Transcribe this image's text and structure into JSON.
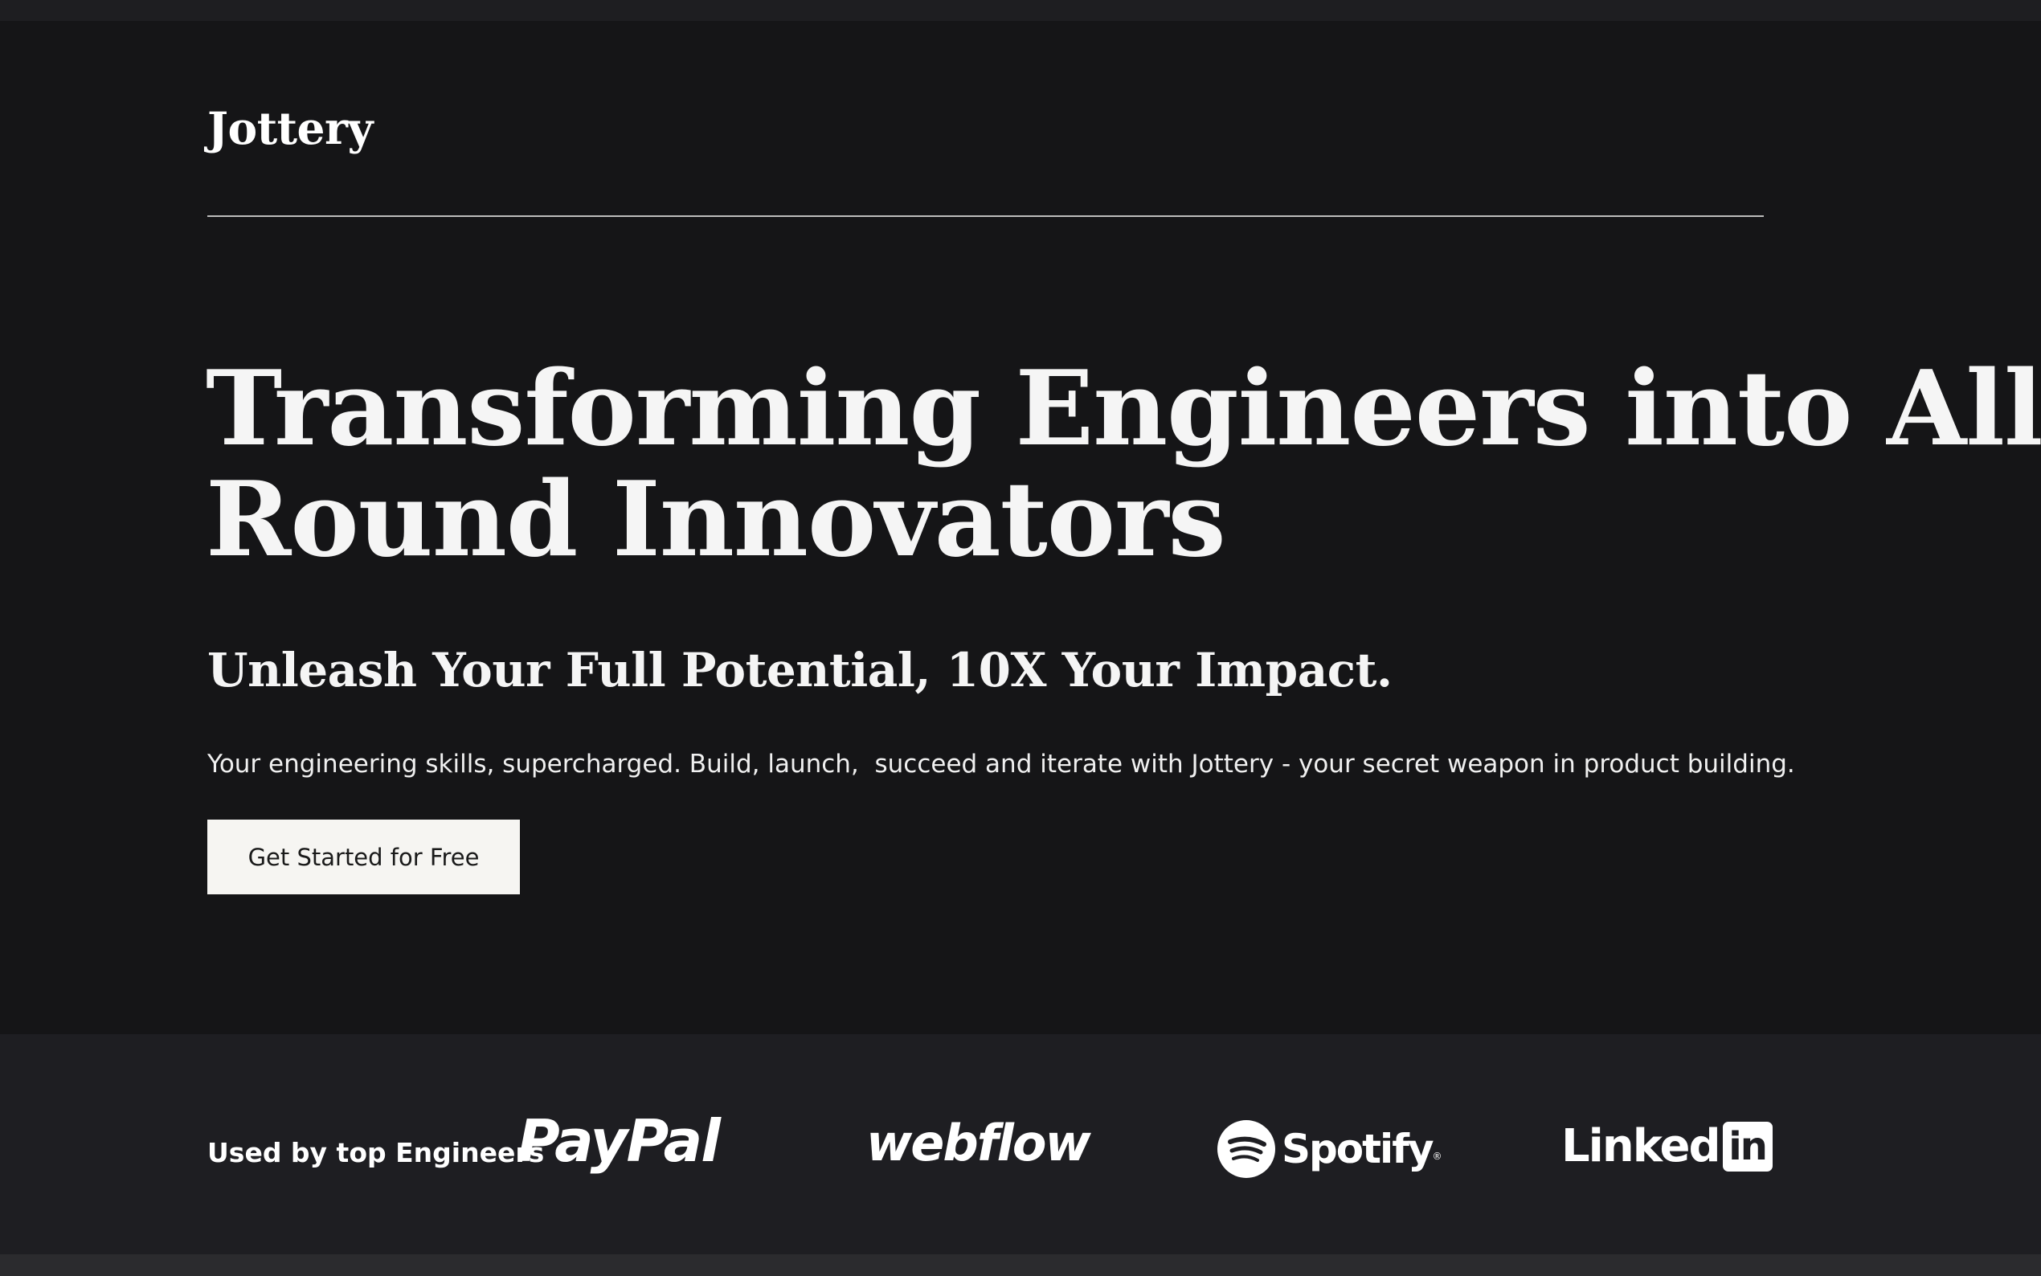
{
  "header": {
    "logo": "Jottery"
  },
  "hero": {
    "headline_line1": "Transforming Engineers into All-",
    "headline_line2": "Round Innovators",
    "subheadline": "Unleash Your Full Potential, 10X Your Impact.",
    "description": "Your engineering skills, supercharged. Build, launch,  succeed and iterate with Jottery - your secret weapon in product building.",
    "cta_label": "Get Started for Free"
  },
  "logos": {
    "label": "Used by top Engineers",
    "brands": [
      "PayPal",
      "webflow",
      "Spotify",
      "Linkedin"
    ],
    "linkedin_word": "Linked",
    "linkedin_box": "in"
  },
  "colors": {
    "background": "#151517",
    "logos_band": "#1e1e22",
    "text": "#ffffff",
    "cta_background": "#f6f5f2"
  }
}
